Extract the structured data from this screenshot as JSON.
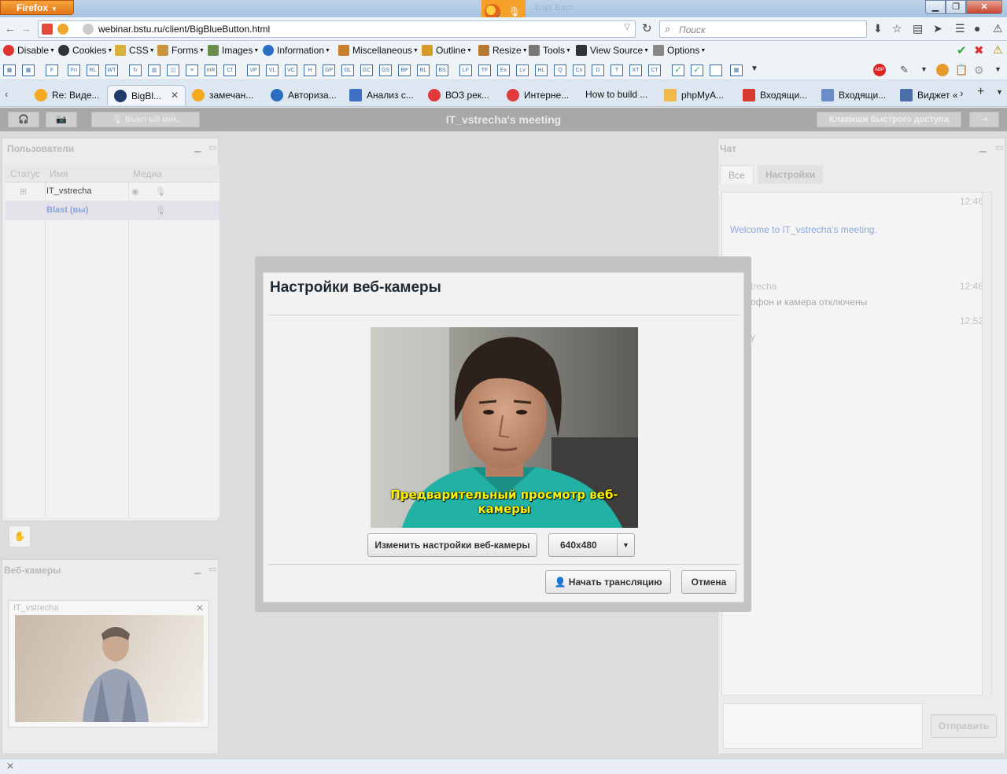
{
  "browser": {
    "app_button": "Firefox",
    "ghost_title": "Барі Баст",
    "url": "webinar.bstu.ru/client/BigBlueButton.html",
    "search_placeholder": "Поиск",
    "toolbar": [
      "Disable",
      "Cookies",
      "CSS",
      "Forms",
      "Images",
      "Information",
      "Miscellaneous",
      "Outline",
      "Resize",
      "Tools",
      "View Source",
      "Options"
    ],
    "iconbar": [
      "F",
      "Fn",
      "RL",
      "WT",
      "",
      "",
      "",
      "",
      "mR",
      "Cf",
      "VP",
      "VL",
      "VC",
      "H",
      "GP",
      "GL",
      "GC",
      "GS",
      "BP",
      "BL",
      "BS",
      "LF",
      "TF",
      "Ex",
      "Lv",
      "HL",
      "Q",
      "Cn",
      "D",
      "T",
      "XT",
      "CT"
    ],
    "tabs": [
      "Re: Виде...",
      "BigBl...",
      "замечан...",
      "Авториза...",
      "Анализ с...",
      "ВОЗ рек...",
      "Интерне...",
      "How to build ...",
      "phpMyA...",
      "Входящи...",
      "Входящи...",
      "Виджет «"
    ]
  },
  "app": {
    "meeting_title": "IT_vstrecha's meeting",
    "mic_button": "Выкл-ый мик.",
    "shortcuts_button": "Клавиши быстрого доступа"
  },
  "users": {
    "title": "Пользователи",
    "columns": [
      "Статус",
      "Имя",
      "Медиа"
    ],
    "rows": [
      {
        "name": "IT_vstrecha"
      },
      {
        "name": "Blast (вы)"
      }
    ]
  },
  "webcams": {
    "title": "Веб-камеры",
    "feed_name": "IT_vstrecha"
  },
  "chat": {
    "title": "Чат",
    "tabs": [
      "Все",
      "Настройки"
    ],
    "messages": [
      {
        "time": "12:46",
        "text": "Welcome to IT_vstrecha's meeting."
      },
      {
        "time": "12:48",
        "sender": "trecha",
        "text": "офон и камера отключены"
      },
      {
        "time": "12:52",
        "text": "y"
      }
    ],
    "send_button": "Отправить"
  },
  "modal": {
    "title": "Настройки веб-камеры",
    "preview_caption": "Предварительный просмотр веб-камеры",
    "change_settings": "Изменить настройки веб-камеры",
    "resolution": "640x480",
    "start_button": "Начать трансляцию",
    "cancel_button": "Отмена"
  },
  "colors": {
    "caption": "#fff200",
    "link": "#5b7fd0"
  }
}
